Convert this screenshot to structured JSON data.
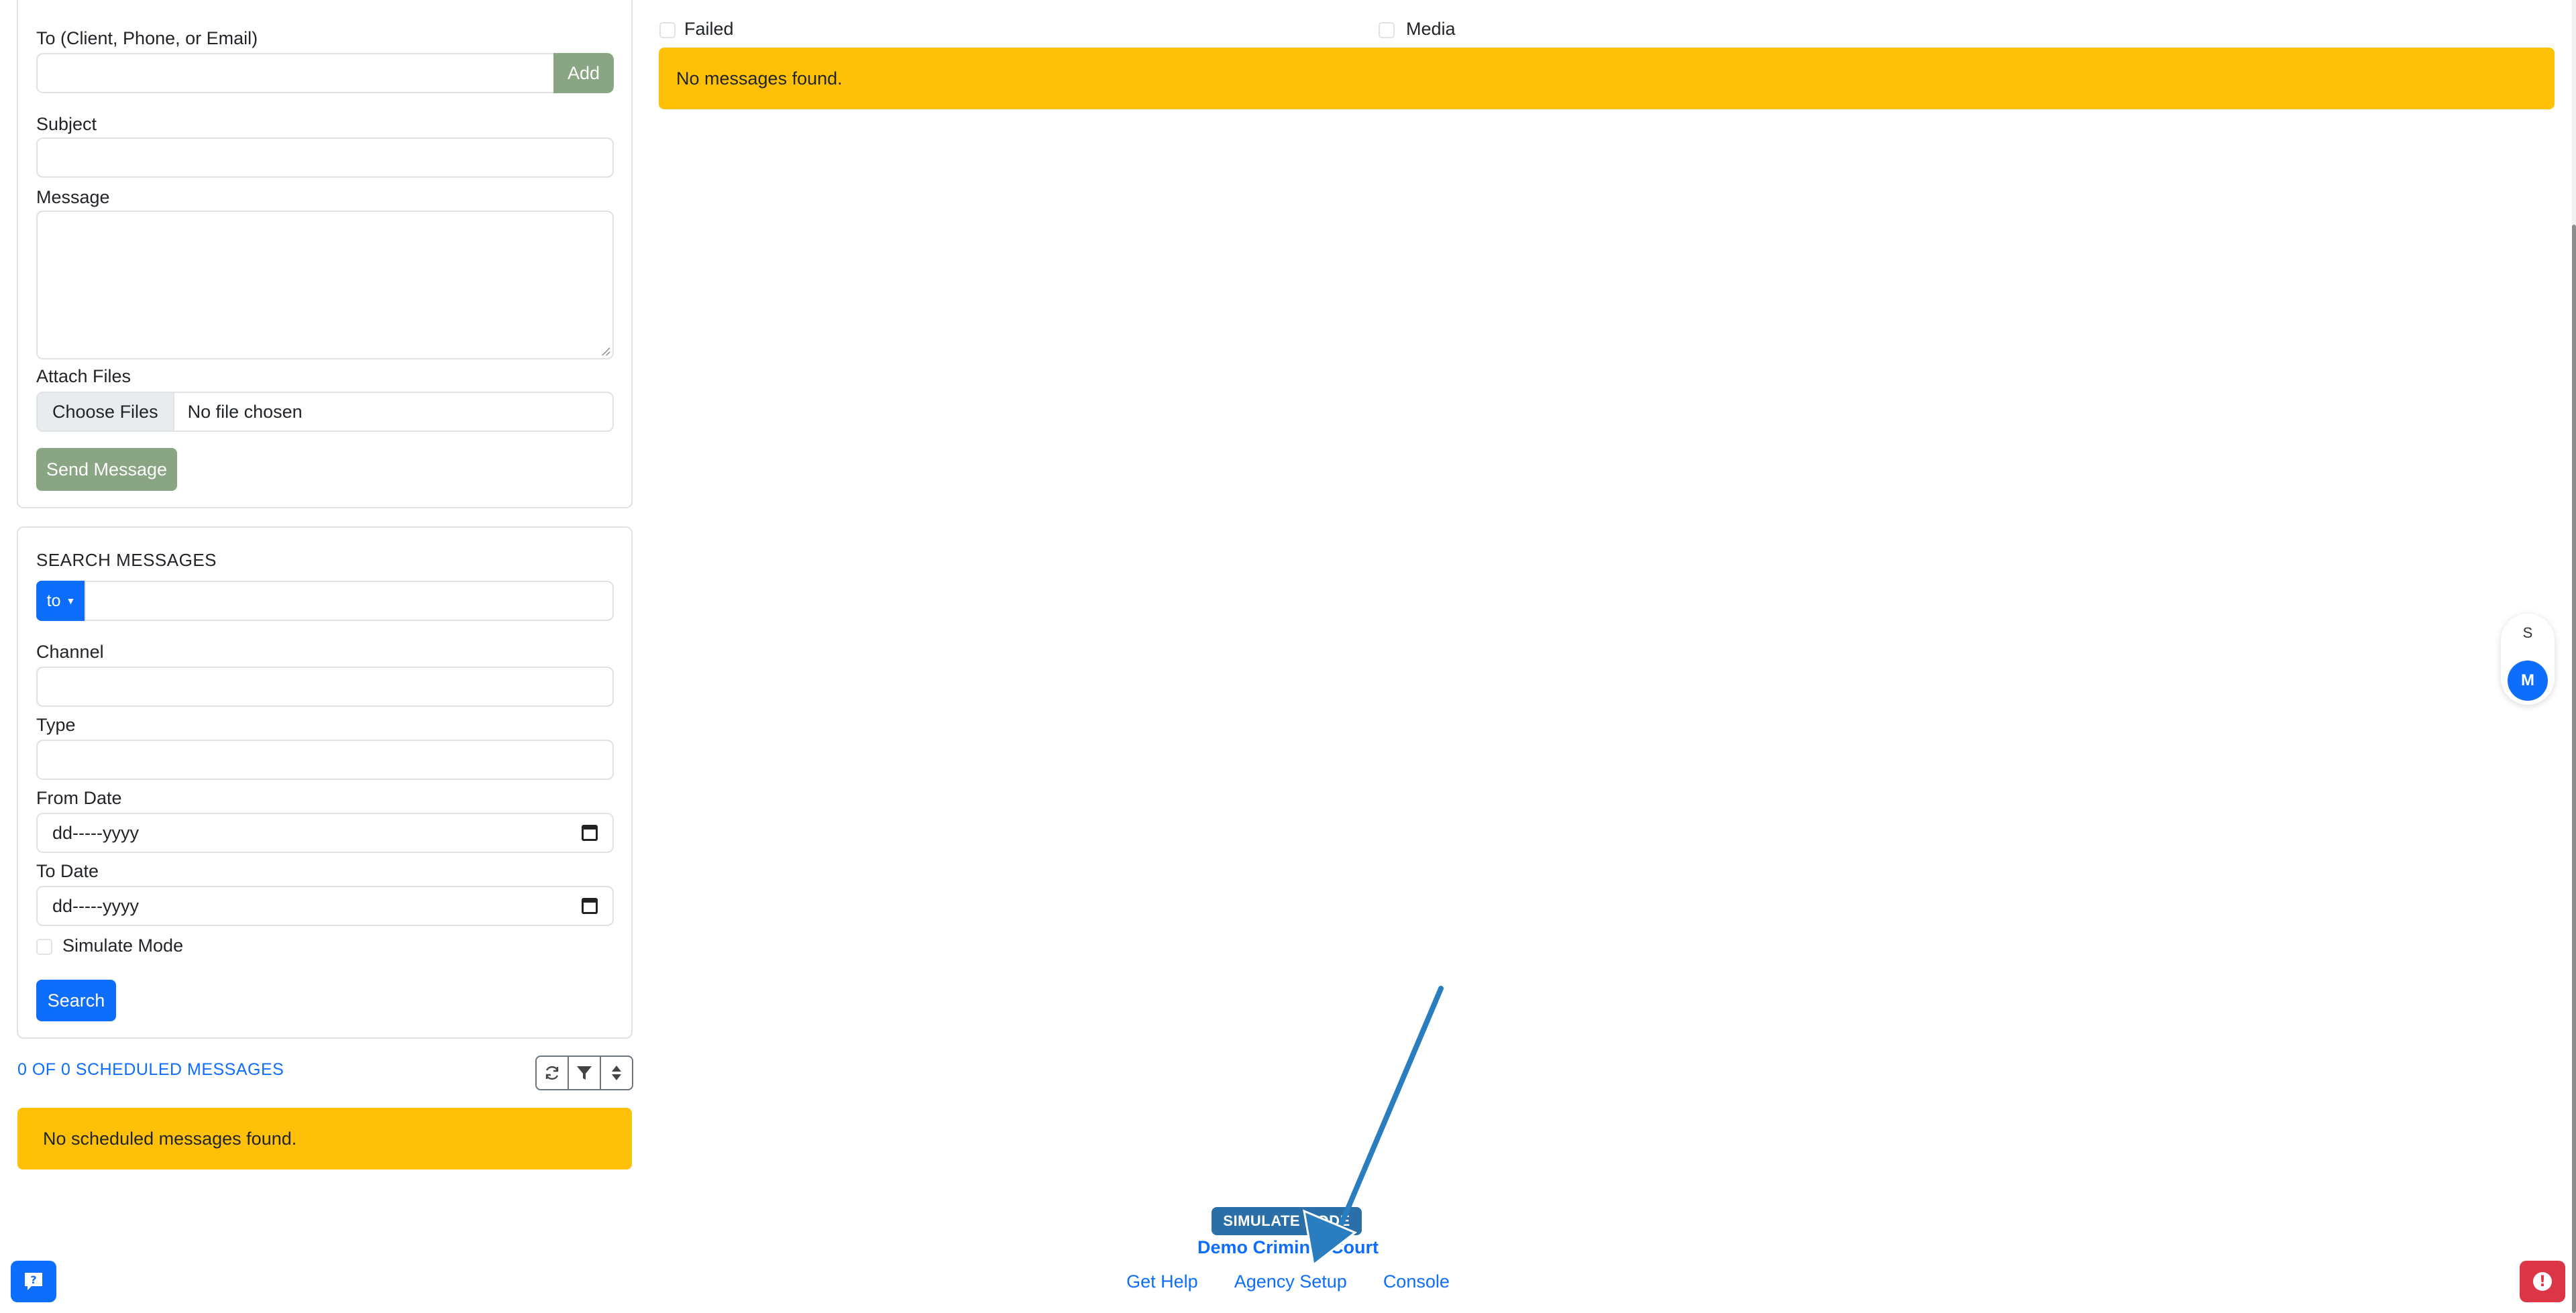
{
  "compose": {
    "to_label": "To (Client, Phone, or Email)",
    "add_label": "Add",
    "subject_label": "Subject",
    "message_label": "Message",
    "attach_label": "Attach Files",
    "choose_files_label": "Choose Files",
    "no_file_label": "No file chosen",
    "send_label": "Send Message"
  },
  "search": {
    "title": "SEARCH MESSAGES",
    "to_dropdown": "to",
    "channel_label": "Channel",
    "type_label": "Type",
    "from_date_label": "From Date",
    "from_date_value": "dd-----yyyy",
    "to_date_label": "To Date",
    "to_date_value": "dd-----yyyy",
    "simulate_label": "Simulate Mode",
    "search_label": "Search"
  },
  "scheduled": {
    "count_label": "0 OF 0 SCHEDULED MESSAGES",
    "empty_label": "No scheduled messages found."
  },
  "main": {
    "filters": {
      "failed_label": "Failed",
      "media_label": "Media"
    },
    "empty_label": "No messages found."
  },
  "side_pill": {
    "s_label": "S",
    "m_label": "M"
  },
  "footer": {
    "simulate_badge": "SIMULATE MODE",
    "agency_name": "Demo Criminal Court",
    "links": [
      "Get Help",
      "Agency Setup",
      "Console"
    ]
  },
  "fabs": {
    "alert_glyph": "!"
  },
  "icons": {
    "refresh": "refresh-icon",
    "filter": "filter-icon",
    "sort": "sort-icon",
    "calendar": "calendar-icon",
    "help": "help-chat-icon",
    "alert": "alert-icon"
  },
  "colors": {
    "primary": "#0d6efd",
    "muted_success": "#89a583",
    "warning": "#ffc107",
    "danger": "#dc3545",
    "annotation": "#2a7ec0"
  }
}
